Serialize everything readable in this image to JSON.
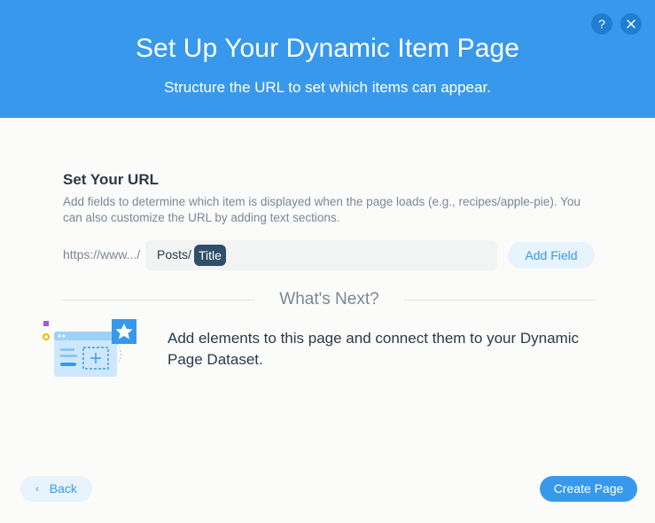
{
  "header": {
    "title": "Set Up Your Dynamic Item Page",
    "subtitle": "Structure the URL to set which items can appear.",
    "help_label": "?",
    "help_icon": "question-icon",
    "close_icon": "close-icon"
  },
  "url_section": {
    "title": "Set Your URL",
    "description": "Add fields to determine which item is displayed when the page loads (e.g., recipes/apple-pie). You can also customize the URL by adding text sections.",
    "prefix": "https://www.../",
    "url_text": "Posts/",
    "url_field_tag": "Title",
    "add_field_label": "Add Field"
  },
  "whats_next": {
    "heading": "What's Next?",
    "text": "Add elements to this page and connect them to your Dynamic Page Dataset.",
    "illustration_icon": "page-elements-illustration"
  },
  "footer": {
    "back_label": "Back",
    "back_icon": "chevron-left-icon",
    "create_label": "Create Page"
  },
  "colors": {
    "accent": "#3899ec",
    "tag": "#2f4e6b",
    "light_button": "#e7f3fd"
  }
}
